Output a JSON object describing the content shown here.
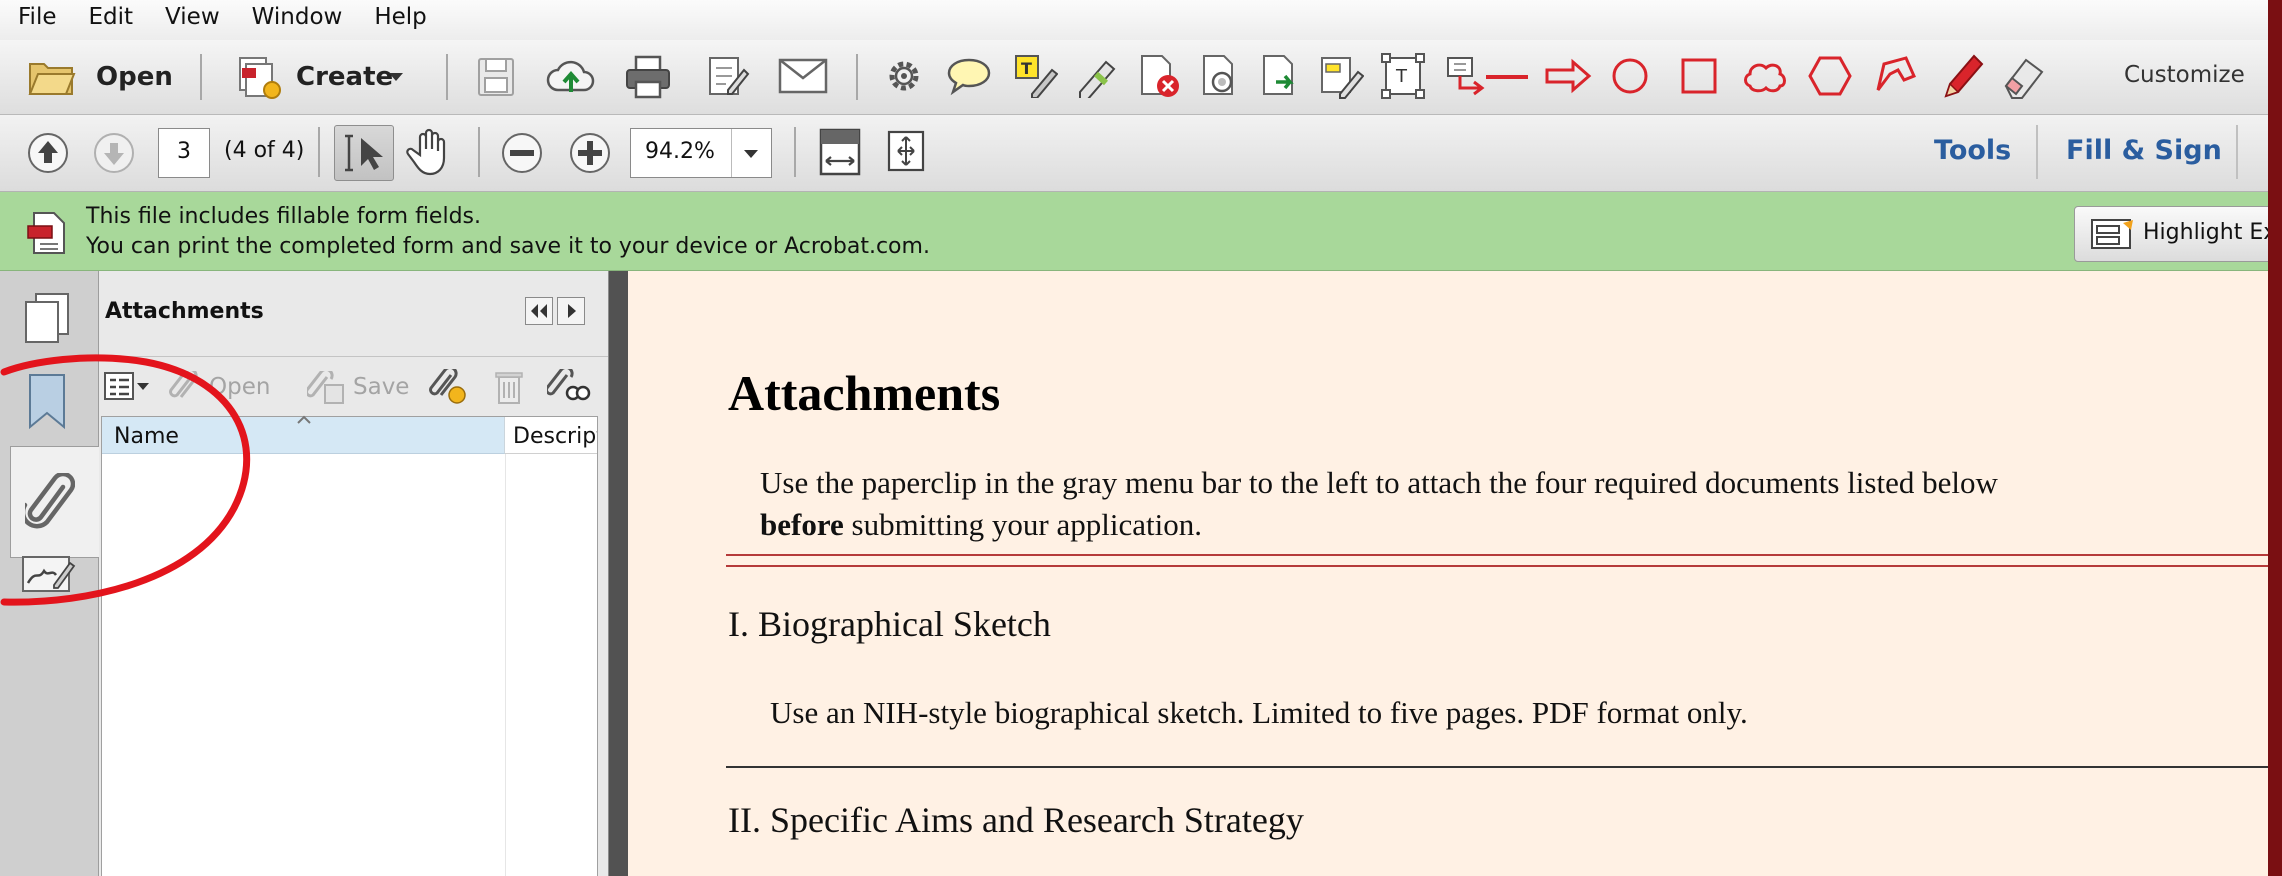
{
  "menu": [
    "File",
    "Edit",
    "View",
    "Window",
    "Help"
  ],
  "toolbar": {
    "open_label": "Open",
    "create_label": "Create",
    "customize_label": "Customize"
  },
  "nav": {
    "page_number": "3",
    "page_count": "(4 of 4)",
    "zoom": "94.2%",
    "tools_label": "Tools",
    "fill_sign_label": "Fill & Sign"
  },
  "notice": {
    "line1": "This file includes fillable form fields.",
    "line2": "You can print the completed form and save it to your device or Acrobat.com.",
    "highlight_label": "Highlight Ex"
  },
  "panel": {
    "title": "Attachments",
    "open_label": "Open",
    "save_label": "Save",
    "columns": [
      "Name",
      "Descript"
    ]
  },
  "document": {
    "heading": "Attachments",
    "intro_line1": "Use the paperclip in the gray menu bar to the left to attach the four required documents listed below",
    "intro_bold": "before",
    "intro_line2_rest": " submitting your application.",
    "section1_title": "I. Biographical Sketch",
    "section1_text": "Use an NIH-style biographical sketch. Limited to five pages. PDF format only.",
    "section2_title": "II. Specific Aims and Research Strategy"
  },
  "colors": {
    "frame": "#7a0f12",
    "notice_bg": "#a8d89a",
    "page_bg": "#fff1e4",
    "link_blue": "#2a5d9f",
    "annotation_red": "#e3141c",
    "rule_red": "#b53a3a"
  }
}
